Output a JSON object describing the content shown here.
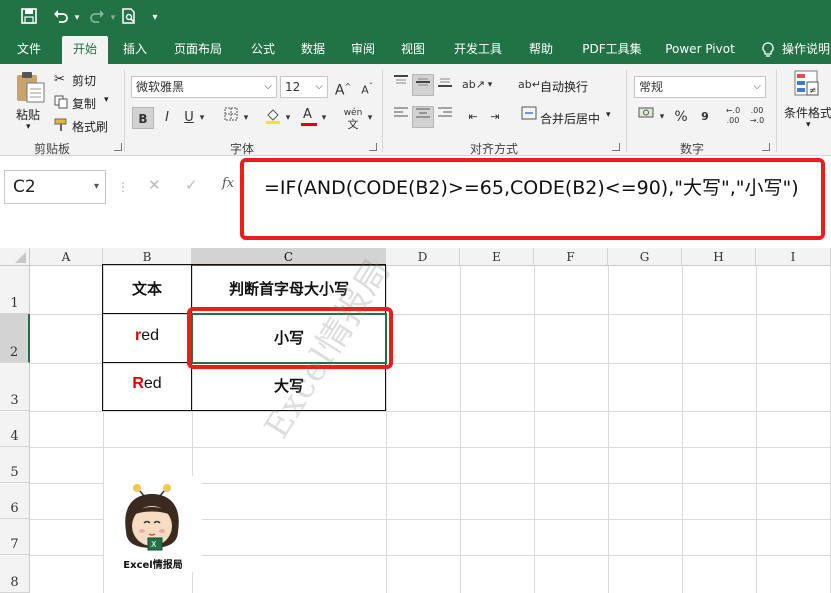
{
  "qat": {
    "icons": [
      "save-icon",
      "undo-icon",
      "redo-icon",
      "print-preview-icon",
      "customize-qat-icon"
    ]
  },
  "tabs": [
    "文件",
    "开始",
    "插入",
    "页面布局",
    "公式",
    "数据",
    "审阅",
    "视图",
    "开发工具",
    "帮助",
    "PDF工具集",
    "Power Pivot",
    "操作说明"
  ],
  "active_tab": "开始",
  "ribbon": {
    "clipboard": {
      "paste": "粘贴",
      "cut": "剪切",
      "copy": "复制",
      "format_painter": "格式刷",
      "label": "剪贴板"
    },
    "font": {
      "name": "微软雅黑",
      "size": "12",
      "bold": "B",
      "italic": "I",
      "underline": "U",
      "label": "字体",
      "grow": "A",
      "shrink": "A",
      "font_color": "A",
      "phonetic": "wén"
    },
    "alignment": {
      "wrap": "自动换行",
      "merge": "合并后居中",
      "label": "对齐方式"
    },
    "number": {
      "format": "常规",
      "percent": "%",
      "comma": "9",
      "inc_dec": "←.0",
      "dec_dec": ".00",
      "label": "数字"
    },
    "styles": {
      "conditional": "条件格式"
    }
  },
  "formula_bar": {
    "name_box": "C2",
    "cancel": "✕",
    "enter": "✓",
    "fx": "fx",
    "formula": "=IF(AND(CODE(B2)>=65,CODE(B2)<=90),\"大写\",\"小写\")"
  },
  "columns": [
    "A",
    "B",
    "C",
    "D",
    "E",
    "F",
    "G",
    "H",
    "I"
  ],
  "selected_column": "C",
  "rows": [
    "1",
    "2",
    "3",
    "4",
    "5",
    "6",
    "7",
    "8"
  ],
  "selected_row": "2",
  "cells": {
    "B1": "文本",
    "C1": "判断首字母大小写",
    "B2_first": "r",
    "B2_rest": "ed",
    "C2": "小写",
    "B3_first": "R",
    "B3_rest": "ed",
    "C3": "大写"
  },
  "watermark": "Excel情报局",
  "logo_caption": "Excel情报局",
  "colors": {
    "excel_green": "#217346",
    "highlight_red": "#ee1c1c"
  }
}
